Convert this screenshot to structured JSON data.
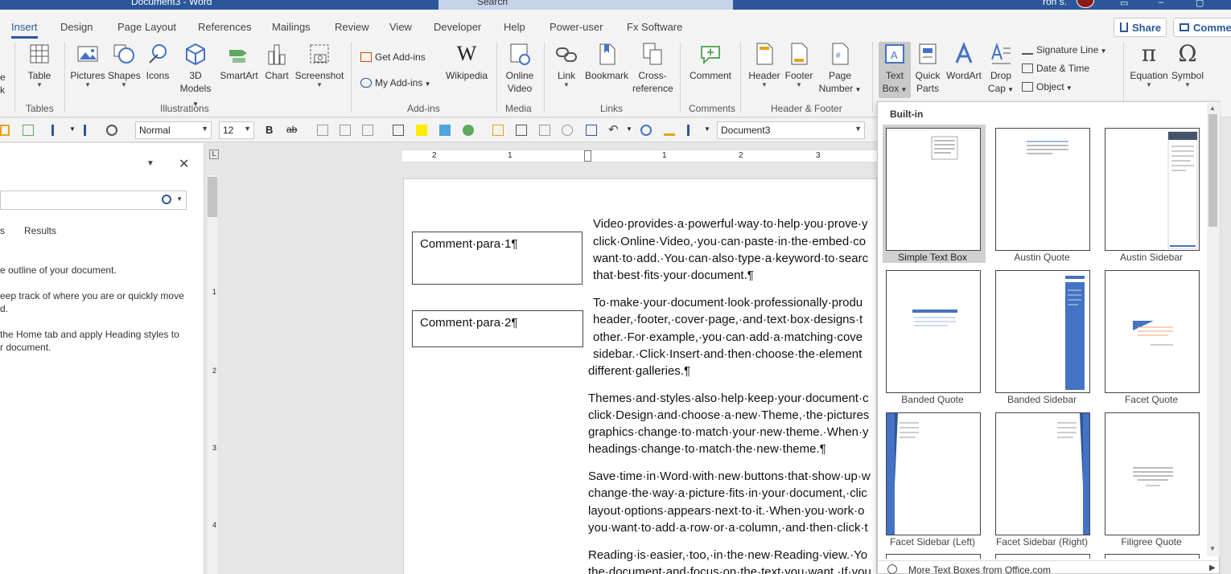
{
  "titlebar": {
    "doc_title": "Document3 - Word",
    "search_placeholder": "Search",
    "user_name": "ron s."
  },
  "tabs": [
    {
      "label": "Insert",
      "active": true
    },
    {
      "label": "Design"
    },
    {
      "label": "Page Layout"
    },
    {
      "label": "References"
    },
    {
      "label": "Mailings"
    },
    {
      "label": "Review"
    },
    {
      "label": "View"
    },
    {
      "label": "Developer"
    },
    {
      "label": "Help"
    },
    {
      "label": "Power-user"
    },
    {
      "label": "Fx Software"
    }
  ],
  "share_label": "Share",
  "comments_label": "Comme",
  "ribbon": {
    "partial_left": {
      "line1": "e",
      "line2": "k"
    },
    "table": "Table",
    "tables_group": "Tables",
    "pictures": "Pictures",
    "shapes": "Shapes",
    "icons": "Icons",
    "models_line1": "3D",
    "models_line2": "Models",
    "smartart": "SmartArt",
    "chart": "Chart",
    "screenshot": "Screenshot",
    "illustrations_group": "Illustrations",
    "get_addins": "Get Add-ins",
    "my_addins": "My Add-ins",
    "wikipedia": "Wikipedia",
    "addins_group": "Add-ins",
    "online_video_line1": "Online",
    "online_video_line2": "Video",
    "media_group": "Media",
    "link": "Link",
    "bookmark": "Bookmark",
    "crossref_line1": "Cross-",
    "crossref_line2": "reference",
    "links_group": "Links",
    "comment": "Comment",
    "comments_group": "Comments",
    "header": "Header",
    "footer": "Footer",
    "page_number_line1": "Page",
    "page_number_line2": "Number",
    "header_footer_group": "Header & Footer",
    "text_box_line1": "Text",
    "text_box_line2": "Box",
    "quick_parts_line1": "Quick",
    "quick_parts_line2": "Parts",
    "wordart": "WordArt",
    "drop_cap_line1": "Drop",
    "drop_cap_line2": "Cap",
    "signature_line": "Signature Line",
    "date_time": "Date & Time",
    "object": "Object",
    "equation": "Equation",
    "symbol": "Symbol"
  },
  "format_bar": {
    "style": "Normal",
    "size": "12",
    "bold": "B",
    "strike": "ab",
    "document": "Document3"
  },
  "navpane": {
    "tab_partial": "s",
    "results_tab": "Results",
    "lines": [
      "e outline of your document.",
      "eep track of where you are or quickly move",
      "d.",
      "the Home tab and apply Heading styles to",
      "r document."
    ]
  },
  "ruler_numbers": [
    "2",
    "1",
    "1",
    "2",
    "3"
  ],
  "ruler_v_numbers": [
    "1",
    "2",
    "3",
    "4"
  ],
  "document": {
    "comment1": "Comment·para·1¶",
    "comment2": "Comment·para·2¶",
    "lines": [
      "Video·provides·a·powerful·way·to·help·you·prove·y",
      "click·Online·Video,·you·can·paste·in·the·embed·co",
      "want·to·add.·You·can·also·type·a·keyword·to·searc",
      "that·best·fits·your·document.¶",
      "To·make·your·document·look·professionally·produ",
      "header,·footer,·cover·page,·and·text·box·designs·t",
      "other.·For·example,·you·can·add·a·matching·cove",
      "sidebar.·Click·Insert·and·then·choose·the·element",
      "different·galleries.¶",
      "Themes·and·styles·also·help·keep·your·document·c",
      "click·Design·and·choose·a·new·Theme,·the·pictures",
      "graphics·change·to·match·your·new·theme.·When·y",
      "headings·change·to·match·the·new·theme.¶",
      "Save·time·in·Word·with·new·buttons·that·show·up·w",
      "change·the·way·a·picture·fits·in·your·document,·clic",
      "layout·options·appears·next·to·it.·When·you·work·o",
      "you·want·to·add·a·row·or·a·column,·and·then·click·t",
      "Reading·is·easier,·too,·in·the·new·Reading·view.·Yo",
      "the·document·and·focus·on·the·text·you·want.·If·you"
    ]
  },
  "gallery": {
    "section": "Built-in",
    "items": [
      {
        "label": "Simple Text Box",
        "selected": true
      },
      {
        "label": "Austin Quote"
      },
      {
        "label": "Austin Sidebar"
      },
      {
        "label": "Banded Quote"
      },
      {
        "label": "Banded Sidebar"
      },
      {
        "label": "Facet Quote"
      },
      {
        "label": "Facet Sidebar (Left)"
      },
      {
        "label": "Facet Sidebar (Right)"
      },
      {
        "label": "Filigree Quote"
      }
    ],
    "more": "More Text Boxes from Office.com"
  },
  "colors": {
    "accent": "#2b579a",
    "thumb_blue": "#4472c4"
  }
}
